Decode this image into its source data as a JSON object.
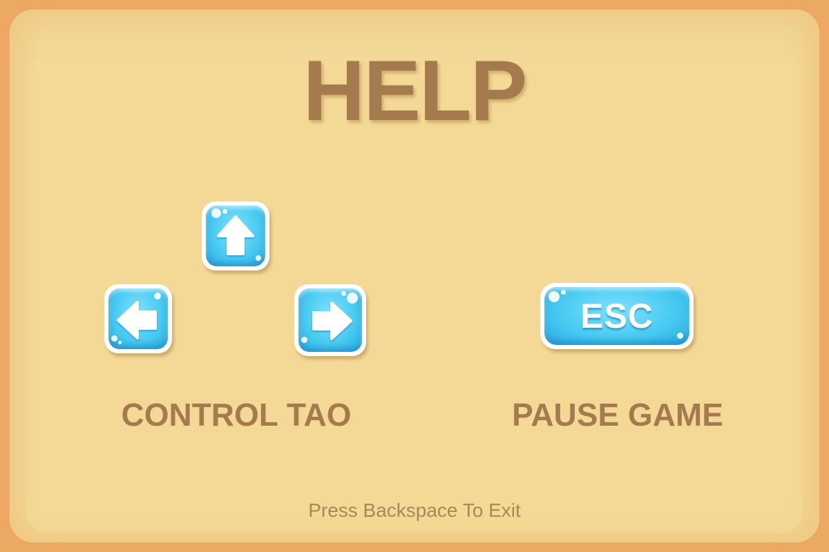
{
  "screen": {
    "title": "HELP",
    "footer_hint": "Press Backspace To Exit"
  },
  "controls": {
    "movement_label": "CONTROL TAO",
    "pause_label": "PAUSE GAME",
    "keys": {
      "up_icon": "arrow-up-icon",
      "left_icon": "arrow-left-icon",
      "right_icon": "arrow-right-icon",
      "esc_label": "ESC"
    }
  },
  "colors": {
    "background_frame": "#eba963",
    "panel": "#f2d896",
    "text_brown": "#a57a4d",
    "key_blue": "#45c8f0",
    "key_border": "#ffffff"
  }
}
